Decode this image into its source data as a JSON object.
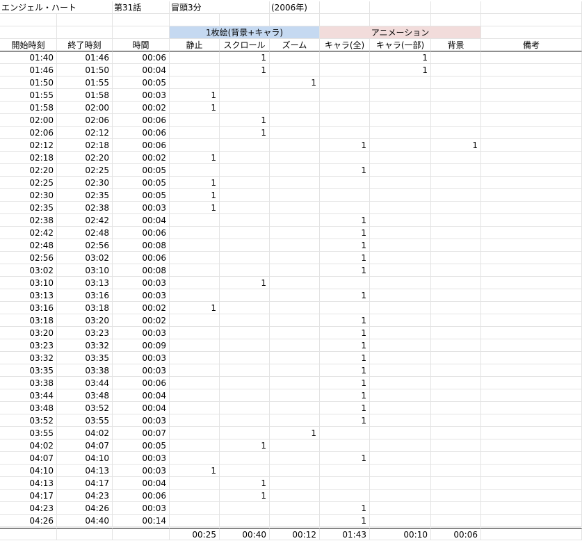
{
  "title_row": {
    "show": "エンジェル・ハート",
    "episode": "第31話",
    "segment": "冒頭3分",
    "year": "(2006年)"
  },
  "group_row": {
    "single_frame": "1枚絵(背景+キャラ)",
    "animation": "アニメーション"
  },
  "columns": [
    "開始時刻",
    "終了時刻",
    "時間",
    "静止",
    "スクロール",
    "ズーム",
    "キャラ(全)",
    "キャラ(一部)",
    "背景",
    "備考"
  ],
  "rows": [
    [
      "01:40",
      "01:46",
      "00:06",
      "",
      "1",
      "",
      "",
      "1",
      "",
      ""
    ],
    [
      "01:46",
      "01:50",
      "00:04",
      "",
      "1",
      "",
      "",
      "1",
      "",
      ""
    ],
    [
      "01:50",
      "01:55",
      "00:05",
      "",
      "",
      "1",
      "",
      "",
      "",
      ""
    ],
    [
      "01:55",
      "01:58",
      "00:03",
      "1",
      "",
      "",
      "",
      "",
      "",
      ""
    ],
    [
      "01:58",
      "02:00",
      "00:02",
      "1",
      "",
      "",
      "",
      "",
      "",
      ""
    ],
    [
      "02:00",
      "02:06",
      "00:06",
      "",
      "1",
      "",
      "",
      "",
      "",
      ""
    ],
    [
      "02:06",
      "02:12",
      "00:06",
      "",
      "1",
      "",
      "",
      "",
      "",
      ""
    ],
    [
      "02:12",
      "02:18",
      "00:06",
      "",
      "",
      "",
      "1",
      "",
      "1",
      ""
    ],
    [
      "02:18",
      "02:20",
      "00:02",
      "1",
      "",
      "",
      "",
      "",
      "",
      ""
    ],
    [
      "02:20",
      "02:25",
      "00:05",
      "",
      "",
      "",
      "1",
      "",
      "",
      ""
    ],
    [
      "02:25",
      "02:30",
      "00:05",
      "1",
      "",
      "",
      "",
      "",
      "",
      ""
    ],
    [
      "02:30",
      "02:35",
      "00:05",
      "1",
      "",
      "",
      "",
      "",
      "",
      ""
    ],
    [
      "02:35",
      "02:38",
      "00:03",
      "1",
      "",
      "",
      "",
      "",
      "",
      ""
    ],
    [
      "02:38",
      "02:42",
      "00:04",
      "",
      "",
      "",
      "1",
      "",
      "",
      ""
    ],
    [
      "02:42",
      "02:48",
      "00:06",
      "",
      "",
      "",
      "1",
      "",
      "",
      ""
    ],
    [
      "02:48",
      "02:56",
      "00:08",
      "",
      "",
      "",
      "1",
      "",
      "",
      ""
    ],
    [
      "02:56",
      "03:02",
      "00:06",
      "",
      "",
      "",
      "1",
      "",
      "",
      ""
    ],
    [
      "03:02",
      "03:10",
      "00:08",
      "",
      "",
      "",
      "1",
      "",
      "",
      ""
    ],
    [
      "03:10",
      "03:13",
      "00:03",
      "",
      "1",
      "",
      "",
      "",
      "",
      ""
    ],
    [
      "03:13",
      "03:16",
      "00:03",
      "",
      "",
      "",
      "1",
      "",
      "",
      ""
    ],
    [
      "03:16",
      "03:18",
      "00:02",
      "1",
      "",
      "",
      "",
      "",
      "",
      ""
    ],
    [
      "03:18",
      "03:20",
      "00:02",
      "",
      "",
      "",
      "1",
      "",
      "",
      ""
    ],
    [
      "03:20",
      "03:23",
      "00:03",
      "",
      "",
      "",
      "1",
      "",
      "",
      ""
    ],
    [
      "03:23",
      "03:32",
      "00:09",
      "",
      "",
      "",
      "1",
      "",
      "",
      ""
    ],
    [
      "03:32",
      "03:35",
      "00:03",
      "",
      "",
      "",
      "1",
      "",
      "",
      ""
    ],
    [
      "03:35",
      "03:38",
      "00:03",
      "",
      "",
      "",
      "1",
      "",
      "",
      ""
    ],
    [
      "03:38",
      "03:44",
      "00:06",
      "",
      "",
      "",
      "1",
      "",
      "",
      ""
    ],
    [
      "03:44",
      "03:48",
      "00:04",
      "",
      "",
      "",
      "1",
      "",
      "",
      ""
    ],
    [
      "03:48",
      "03:52",
      "00:04",
      "",
      "",
      "",
      "1",
      "",
      "",
      ""
    ],
    [
      "03:52",
      "03:55",
      "00:03",
      "",
      "",
      "",
      "1",
      "",
      "",
      ""
    ],
    [
      "03:55",
      "04:02",
      "00:07",
      "",
      "",
      "1",
      "",
      "",
      "",
      ""
    ],
    [
      "04:02",
      "04:07",
      "00:05",
      "",
      "1",
      "",
      "",
      "",
      "",
      ""
    ],
    [
      "04:07",
      "04:10",
      "00:03",
      "",
      "",
      "",
      "1",
      "",
      "",
      ""
    ],
    [
      "04:10",
      "04:13",
      "00:03",
      "1",
      "",
      "",
      "",
      "",
      "",
      ""
    ],
    [
      "04:13",
      "04:17",
      "00:04",
      "",
      "1",
      "",
      "",
      "",
      "",
      ""
    ],
    [
      "04:17",
      "04:23",
      "00:06",
      "",
      "1",
      "",
      "",
      "",
      "",
      ""
    ],
    [
      "04:23",
      "04:26",
      "00:03",
      "",
      "",
      "",
      "1",
      "",
      "",
      ""
    ],
    [
      "04:26",
      "04:40",
      "00:14",
      "",
      "",
      "",
      "1",
      "",
      "",
      ""
    ]
  ],
  "totals": [
    "",
    "",
    "",
    "00:25",
    "00:40",
    "00:12",
    "01:43",
    "00:10",
    "00:06",
    ""
  ],
  "colors": {
    "single_frame_band": "#c5d9f1",
    "animation_band": "#f2dcdb",
    "gridline": "#e3e3e3"
  }
}
